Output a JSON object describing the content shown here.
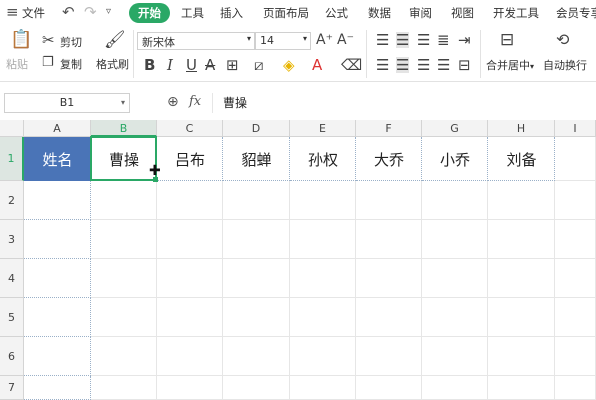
{
  "menubar": {
    "file_label": "文件",
    "tabs": [
      "开始",
      "工具",
      "插入",
      "页面布局",
      "公式",
      "数据",
      "审阅",
      "视图",
      "开发工具",
      "会员专享"
    ],
    "active_tab": "开始"
  },
  "ribbon": {
    "paste_label": "粘贴",
    "cut_label": "剪切",
    "copy_label": "复制",
    "format_painter_label": "格式刷",
    "font_name": "新宋体",
    "font_size": "14",
    "merge_label": "合并居中",
    "wrap_label": "自动换行"
  },
  "formula_bar": {
    "name_box": "B1",
    "fx_label": "fx",
    "content": "曹操"
  },
  "sheet": {
    "columns": [
      "A",
      "B",
      "C",
      "D",
      "E",
      "F",
      "G",
      "H",
      "I"
    ],
    "rows": [
      "1",
      "2",
      "3",
      "4",
      "5",
      "6",
      "7"
    ],
    "row1": [
      "姓名",
      "曹操",
      "吕布",
      "貂蝉",
      "孙权",
      "大乔",
      "小乔",
      "刘备"
    ],
    "selected_cell": "B1",
    "header_fill": "#4a74b7",
    "accent": "#2aa866"
  }
}
